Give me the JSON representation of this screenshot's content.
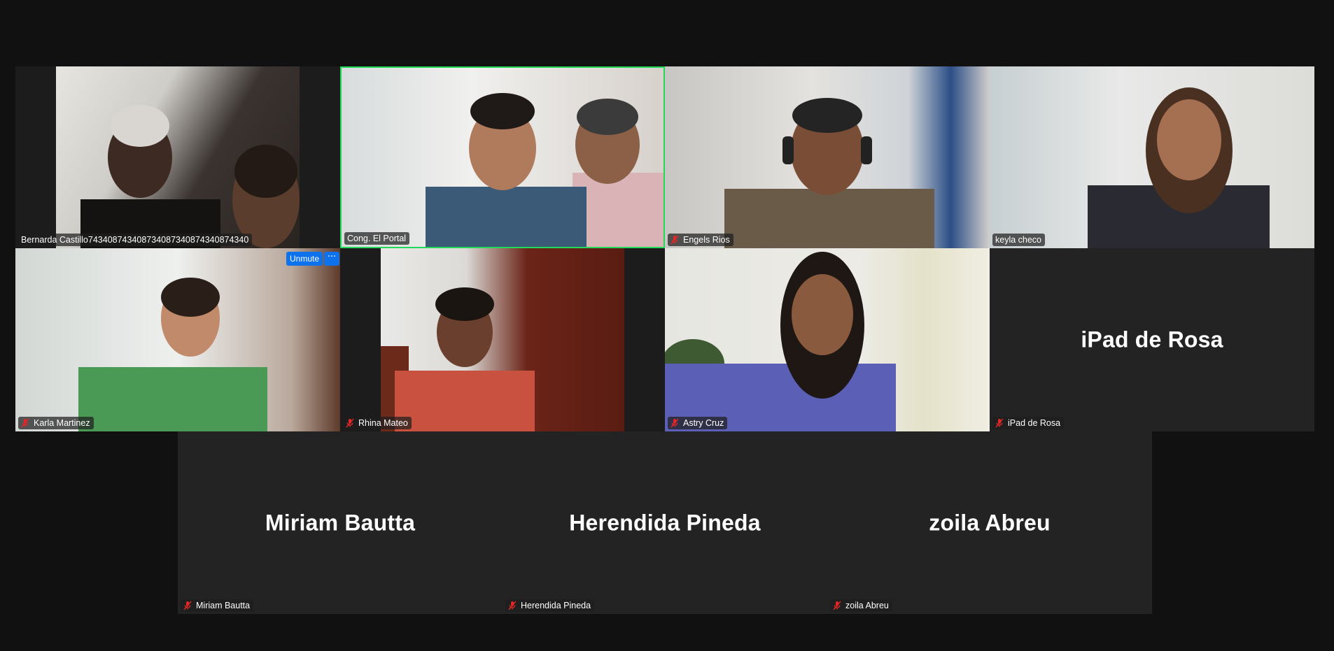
{
  "participants": {
    "bernarda": {
      "name": "Bernarda Castillo743408743408734087340874340874340"
    },
    "portal": {
      "name": "Cong. El Portal"
    },
    "engels": {
      "name": "Engels Rios"
    },
    "keyla": {
      "name": "keyla checo"
    },
    "karla": {
      "name": "Karla Martinez"
    },
    "rhina": {
      "name": "Rhina Mateo"
    },
    "astry": {
      "name": "Astry Cruz"
    },
    "ipad": {
      "name": "iPad de Rosa",
      "display": "iPad de Rosa"
    },
    "miriam": {
      "name": "Miriam Bautta",
      "display": "Miriam Bautta"
    },
    "herendida": {
      "name": "Herendida Pineda",
      "display": "Herendida Pineda"
    },
    "zoila": {
      "name": "zoila Abreu",
      "display": "zoila Abreu"
    }
  },
  "hover_controls": {
    "unmute_label": "Unmute",
    "more_label": "···"
  },
  "colors": {
    "background": "#111111",
    "tile": "#232323",
    "active_speaker_border": "#23d959",
    "button": "#0e72ed",
    "muted_icon": "#e02828"
  },
  "icons": {
    "muted": "microphone-muted-icon",
    "more": "ellipsis-icon"
  }
}
